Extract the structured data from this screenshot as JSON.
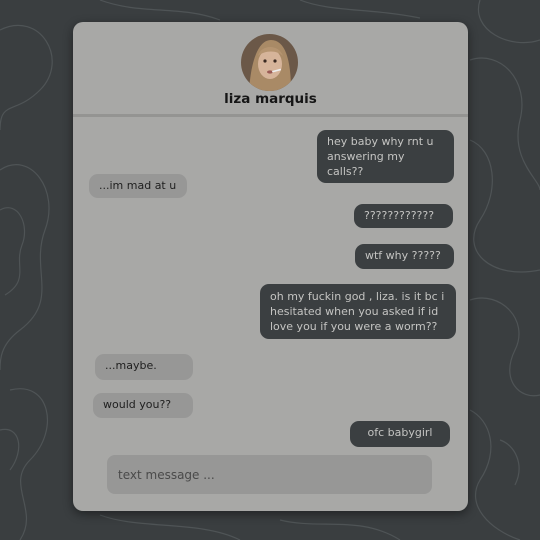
{
  "colors": {
    "background": "#3a3e40",
    "card": "#a8a8a6",
    "sent_bubble": "#3b3f41",
    "received_bubble": "#979796"
  },
  "header": {
    "contact_name": "liza marquis",
    "avatar_icon": "profile-photo"
  },
  "messages": [
    {
      "from": "me",
      "text": "hey baby why rnt u\nanswering my calls??"
    },
    {
      "from": "them",
      "text": "...im mad at u"
    },
    {
      "from": "me",
      "text": "????????????"
    },
    {
      "from": "me",
      "text": "wtf why ?????"
    },
    {
      "from": "me",
      "text": "oh my fuckin god , liza. is it bc i\nhesitated when you asked if id\nlove you if you were a worm??"
    },
    {
      "from": "them",
      "text": "...maybe."
    },
    {
      "from": "them",
      "text": "would you??"
    },
    {
      "from": "me",
      "text": "ofc babygirl"
    }
  ],
  "composer": {
    "placeholder": "text message ..."
  }
}
